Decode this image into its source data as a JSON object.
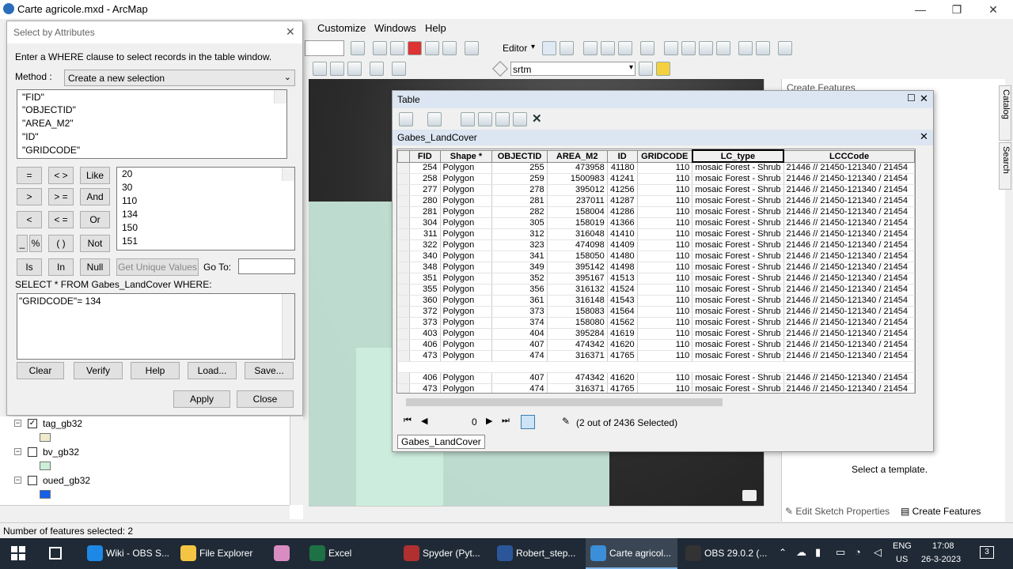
{
  "app": {
    "title": "Carte agricole.mxd - ArcMap"
  },
  "menu": {
    "customize": "Customize",
    "windows": "Windows",
    "help": "Help"
  },
  "toolbar": {
    "editor": "Editor",
    "layer_select": "srtm"
  },
  "dialog": {
    "title": "Select by Attributes",
    "instruction": "Enter a WHERE clause to select records in the table window.",
    "method_label": "Method :",
    "method_value": "Create a new selection",
    "fields": [
      "\"FID\"",
      "\"OBJECTID\"",
      "\"AREA_M2\"",
      "\"ID\"",
      "\"GRIDCODE\""
    ],
    "operators": [
      "=",
      "< >",
      "Like",
      ">",
      "> =",
      "And",
      "<",
      "< =",
      "Or",
      "_",
      "%",
      "( )",
      "Not",
      "Is",
      "In",
      "Null"
    ],
    "values": [
      "20",
      "30",
      "110",
      "134",
      "150",
      "151"
    ],
    "get_unique": "Get Unique Values",
    "goto_label": "Go To:",
    "select_from": "SELECT * FROM Gabes_LandCover WHERE:",
    "query": "\"GRIDCODE\"= 134",
    "buttons": {
      "clear": "Clear",
      "verify": "Verify",
      "help": "Help",
      "load": "Load...",
      "save": "Save...",
      "apply": "Apply",
      "close": "Close"
    }
  },
  "table": {
    "window_title": "Table",
    "layer_name": "Gabes_LandCover",
    "columns": [
      "FID",
      "Shape *",
      "OBJECTID",
      "AREA_M2",
      "ID",
      "GRIDCODE",
      "LC_type",
      "LCCCode"
    ],
    "rows": [
      [
        "254",
        "Polygon",
        "255",
        "473958",
        "41180",
        "110",
        "mosaic Forest - Shrub",
        "21446 // 21450-121340 / 21454"
      ],
      [
        "258",
        "Polygon",
        "259",
        "1500983",
        "41241",
        "110",
        "mosaic Forest - Shrub",
        "21446 // 21450-121340 / 21454"
      ],
      [
        "277",
        "Polygon",
        "278",
        "395012",
        "41256",
        "110",
        "mosaic Forest - Shrub",
        "21446 // 21450-121340 / 21454"
      ],
      [
        "280",
        "Polygon",
        "281",
        "237011",
        "41287",
        "110",
        "mosaic Forest - Shrub",
        "21446 // 21450-121340 / 21454"
      ],
      [
        "281",
        "Polygon",
        "282",
        "158004",
        "41286",
        "110",
        "mosaic Forest - Shrub",
        "21446 // 21450-121340 / 21454"
      ],
      [
        "304",
        "Polygon",
        "305",
        "158019",
        "41366",
        "110",
        "mosaic Forest - Shrub",
        "21446 // 21450-121340 / 21454"
      ],
      [
        "311",
        "Polygon",
        "312",
        "316048",
        "41410",
        "110",
        "mosaic Forest - Shrub",
        "21446 // 21450-121340 / 21454"
      ],
      [
        "322",
        "Polygon",
        "323",
        "474098",
        "41409",
        "110",
        "mosaic Forest - Shrub",
        "21446 // 21450-121340 / 21454"
      ],
      [
        "340",
        "Polygon",
        "341",
        "158050",
        "41480",
        "110",
        "mosaic Forest - Shrub",
        "21446 // 21450-121340 / 21454"
      ],
      [
        "348",
        "Polygon",
        "349",
        "395142",
        "41498",
        "110",
        "mosaic Forest - Shrub",
        "21446 // 21450-121340 / 21454"
      ],
      [
        "351",
        "Polygon",
        "352",
        "395167",
        "41513",
        "110",
        "mosaic Forest - Shrub",
        "21446 // 21450-121340 / 21454"
      ],
      [
        "355",
        "Polygon",
        "356",
        "316132",
        "41524",
        "110",
        "mosaic Forest - Shrub",
        "21446 // 21450-121340 / 21454"
      ],
      [
        "360",
        "Polygon",
        "361",
        "316148",
        "41543",
        "110",
        "mosaic Forest - Shrub",
        "21446 // 21450-121340 / 21454"
      ],
      [
        "372",
        "Polygon",
        "373",
        "158083",
        "41564",
        "110",
        "mosaic Forest - Shrub",
        "21446 // 21450-121340 / 21454"
      ],
      [
        "373",
        "Polygon",
        "374",
        "158080",
        "41562",
        "110",
        "mosaic Forest - Shrub",
        "21446 // 21450-121340 / 21454"
      ],
      [
        "403",
        "Polygon",
        "404",
        "395284",
        "41619",
        "110",
        "mosaic Forest - Shrub",
        "21446 // 21450-121340 / 21454"
      ],
      [
        "406",
        "Polygon",
        "407",
        "474342",
        "41620",
        "110",
        "mosaic Forest - Shrub",
        "21446 // 21450-121340 / 21454"
      ],
      [
        "473",
        "Polygon",
        "474",
        "316371",
        "41765",
        "110",
        "mosaic Forest - Shrub",
        "21446 // 21450-121340 / 21454"
      ]
    ],
    "selected_rows": [
      [
        "406",
        "Polygon",
        "407",
        "474342",
        "41620",
        "110",
        "mosaic Forest - Shrub",
        "21446 // 21450-121340 / 21454"
      ],
      [
        "473",
        "Polygon",
        "474",
        "316371",
        "41765",
        "110",
        "mosaic Forest - Shrub",
        "21446 // 21450-121340 / 21454"
      ]
    ],
    "record_number": "0",
    "selection_status": "(2 out of 2436 Selected)",
    "tab_label": "Gabes_LandCover"
  },
  "toc": {
    "layers": [
      {
        "name": "tag_gb32",
        "checked": true,
        "swatch": "#efeacc"
      },
      {
        "name": "bv_gb32",
        "checked": false,
        "swatch": "#cdeed8"
      },
      {
        "name": "oued_gb32",
        "checked": false,
        "swatch": "#1460e8"
      }
    ]
  },
  "create_features": {
    "title": "Create Features",
    "select_template": "Select a template.",
    "edit_sketch": "Edit Sketch Properties",
    "create_features_tab": "Create Features",
    "side_tabs": [
      "Catalog",
      "Search"
    ]
  },
  "status": {
    "text": "Number of features selected: 2"
  },
  "taskbar": {
    "apps": [
      {
        "label": "Wiki - OBS S...",
        "color": "#1e88e5"
      },
      {
        "label": "File Explorer",
        "color": "#f4c542"
      },
      {
        "label": "",
        "color": "#d98cc2"
      },
      {
        "label": "Excel",
        "color": "#1e7145"
      },
      {
        "label": "Spyder (Pyt...",
        "color": "#b03030"
      },
      {
        "label": "Robert_step...",
        "color": "#2b579a"
      },
      {
        "label": "Carte agricol...",
        "color": "#3b8ed8"
      },
      {
        "label": "OBS 29.0.2 (...",
        "color": "#333333"
      }
    ],
    "lang": "ENG",
    "region": "US",
    "time": "17:08",
    "date": "26-3-2023",
    "notification_count": "3"
  }
}
